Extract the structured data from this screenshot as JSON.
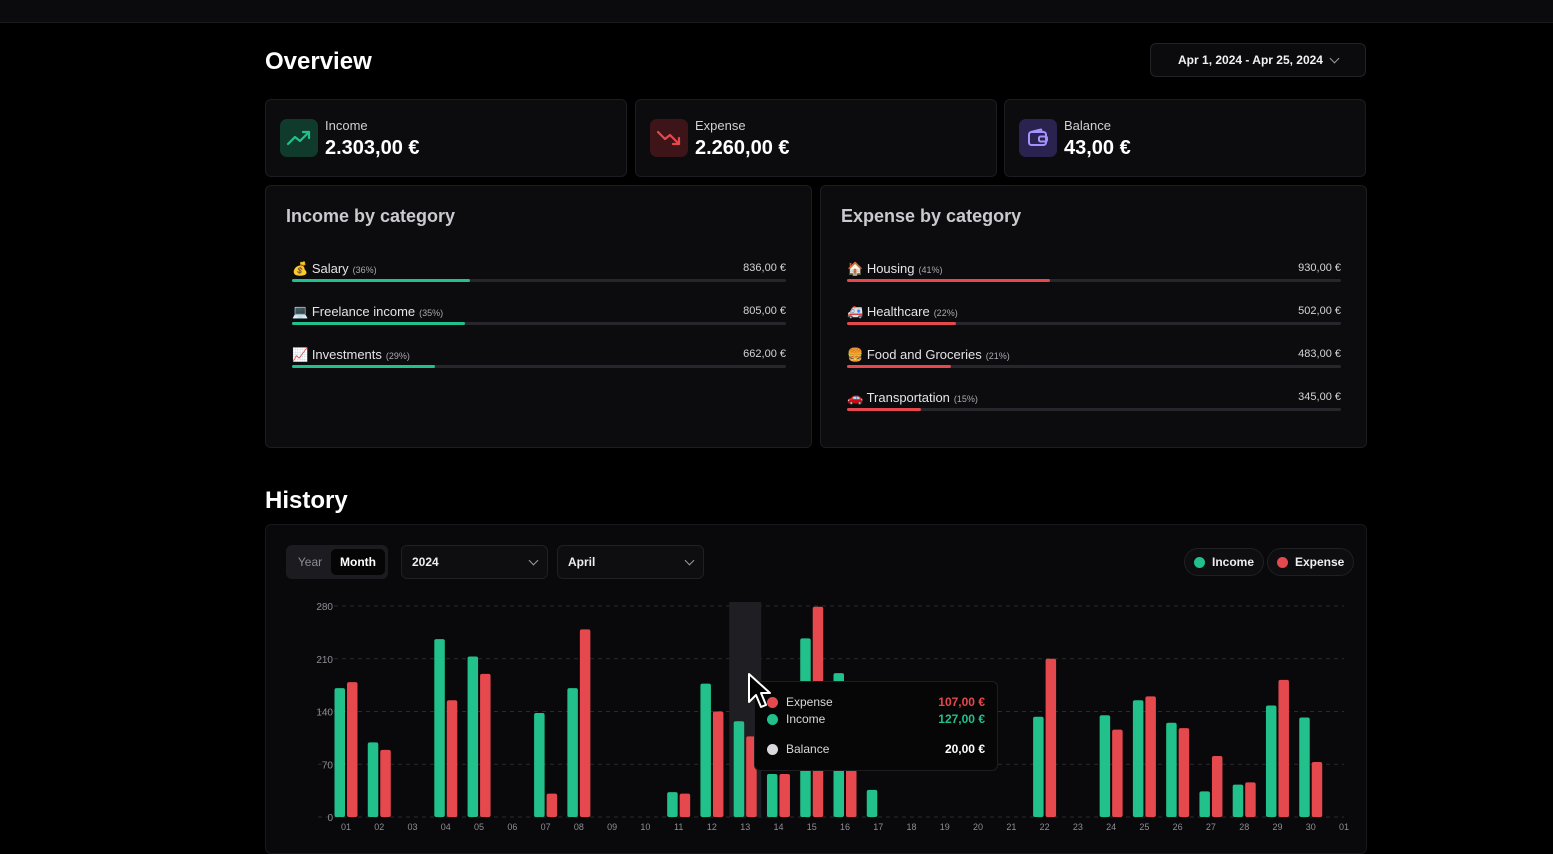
{
  "overview": {
    "title": "Overview",
    "date_range": "Apr 1, 2024 - Apr 25, 2024"
  },
  "stats": [
    {
      "label": "Income",
      "value": "2.303,00 €",
      "icon": "trending-up-icon",
      "color": "#22c08a"
    },
    {
      "label": "Expense",
      "value": "2.260,00 €",
      "icon": "trending-down-icon",
      "color": "#e5484d"
    },
    {
      "label": "Balance",
      "value": "43,00 €",
      "icon": "wallet-icon",
      "color": "#8b7cf6"
    }
  ],
  "income_by_category": {
    "title": "Income by category",
    "items": [
      {
        "emoji": "💰",
        "name": "Salary",
        "pct": "(36%)",
        "amount": "836,00 €",
        "fraction": 0.36
      },
      {
        "emoji": "💻",
        "name": "Freelance income",
        "pct": "(35%)",
        "amount": "805,00 €",
        "fraction": 0.35
      },
      {
        "emoji": "📈",
        "name": "Investments",
        "pct": "(29%)",
        "amount": "662,00 €",
        "fraction": 0.29
      }
    ]
  },
  "expense_by_category": {
    "title": "Expense by category",
    "items": [
      {
        "emoji": "🏠",
        "name": "Housing",
        "pct": "(41%)",
        "amount": "930,00 €",
        "fraction": 0.41
      },
      {
        "emoji": "🚑",
        "name": "Healthcare",
        "pct": "(22%)",
        "amount": "502,00 €",
        "fraction": 0.22
      },
      {
        "emoji": "🍔",
        "name": "Food and Groceries",
        "pct": "(21%)",
        "amount": "483,00 €",
        "fraction": 0.21
      },
      {
        "emoji": "🚗",
        "name": "Transportation",
        "pct": "(15%)",
        "amount": "345,00 €",
        "fraction": 0.15
      }
    ]
  },
  "history": {
    "title": "History",
    "toggle": {
      "year": "Year",
      "month": "Month",
      "active": "Month"
    },
    "year_select": "2024",
    "month_select": "April",
    "legend": {
      "income": "Income",
      "expense": "Expense"
    },
    "tooltip": {
      "expense_label": "Expense",
      "expense_value": "107,00 €",
      "income_label": "Income",
      "income_value": "127,00 €",
      "balance_label": "Balance",
      "balance_value": "20,00 €"
    }
  },
  "chart_data": {
    "type": "bar",
    "categories": [
      "01",
      "02",
      "03",
      "04",
      "05",
      "06",
      "07",
      "08",
      "09",
      "10",
      "11",
      "12",
      "13",
      "14",
      "15",
      "16",
      "17",
      "18",
      "19",
      "20",
      "21",
      "22",
      "23",
      "24",
      "25",
      "26",
      "27",
      "28",
      "29",
      "30",
      "01"
    ],
    "series": [
      {
        "name": "Income",
        "color": "#22c08a",
        "values": [
          171,
          99,
          0,
          236,
          213,
          0,
          138,
          171,
          0,
          0,
          33,
          177,
          127,
          57,
          237,
          191,
          36,
          0,
          0,
          0,
          0,
          133,
          0,
          135,
          155,
          125,
          34,
          43,
          148,
          132,
          0
        ]
      },
      {
        "name": "Expense",
        "color": "#e5484d",
        "values": [
          179,
          89,
          0,
          155,
          190,
          0,
          31,
          249,
          0,
          0,
          31,
          140,
          107,
          57,
          279,
          63,
          0,
          0,
          0,
          0,
          0,
          210,
          0,
          116,
          160,
          118,
          81,
          46,
          182,
          73,
          0
        ]
      }
    ],
    "ylim": [
      0,
      280
    ],
    "yticks": [
      0,
      70,
      140,
      210,
      280
    ],
    "highlight_category": "13",
    "grid": true,
    "legend": "top-right"
  }
}
